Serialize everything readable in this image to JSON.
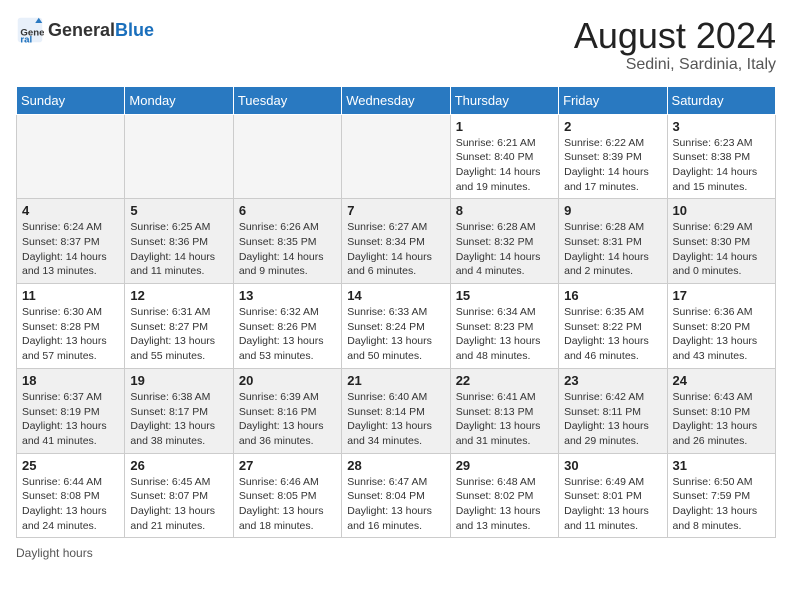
{
  "logo": {
    "text_general": "General",
    "text_blue": "Blue"
  },
  "header": {
    "title": "August 2024",
    "subtitle": "Sedini, Sardinia, Italy"
  },
  "weekdays": [
    "Sunday",
    "Monday",
    "Tuesday",
    "Wednesday",
    "Thursday",
    "Friday",
    "Saturday"
  ],
  "footer": {
    "note": "Daylight hours"
  },
  "weeks": [
    [
      {
        "day": "",
        "info": ""
      },
      {
        "day": "",
        "info": ""
      },
      {
        "day": "",
        "info": ""
      },
      {
        "day": "",
        "info": ""
      },
      {
        "day": "1",
        "info": "Sunrise: 6:21 AM\nSunset: 8:40 PM\nDaylight: 14 hours\nand 19 minutes."
      },
      {
        "day": "2",
        "info": "Sunrise: 6:22 AM\nSunset: 8:39 PM\nDaylight: 14 hours\nand 17 minutes."
      },
      {
        "day": "3",
        "info": "Sunrise: 6:23 AM\nSunset: 8:38 PM\nDaylight: 14 hours\nand 15 minutes."
      }
    ],
    [
      {
        "day": "4",
        "info": "Sunrise: 6:24 AM\nSunset: 8:37 PM\nDaylight: 14 hours\nand 13 minutes."
      },
      {
        "day": "5",
        "info": "Sunrise: 6:25 AM\nSunset: 8:36 PM\nDaylight: 14 hours\nand 11 minutes."
      },
      {
        "day": "6",
        "info": "Sunrise: 6:26 AM\nSunset: 8:35 PM\nDaylight: 14 hours\nand 9 minutes."
      },
      {
        "day": "7",
        "info": "Sunrise: 6:27 AM\nSunset: 8:34 PM\nDaylight: 14 hours\nand 6 minutes."
      },
      {
        "day": "8",
        "info": "Sunrise: 6:28 AM\nSunset: 8:32 PM\nDaylight: 14 hours\nand 4 minutes."
      },
      {
        "day": "9",
        "info": "Sunrise: 6:28 AM\nSunset: 8:31 PM\nDaylight: 14 hours\nand 2 minutes."
      },
      {
        "day": "10",
        "info": "Sunrise: 6:29 AM\nSunset: 8:30 PM\nDaylight: 14 hours\nand 0 minutes."
      }
    ],
    [
      {
        "day": "11",
        "info": "Sunrise: 6:30 AM\nSunset: 8:28 PM\nDaylight: 13 hours\nand 57 minutes."
      },
      {
        "day": "12",
        "info": "Sunrise: 6:31 AM\nSunset: 8:27 PM\nDaylight: 13 hours\nand 55 minutes."
      },
      {
        "day": "13",
        "info": "Sunrise: 6:32 AM\nSunset: 8:26 PM\nDaylight: 13 hours\nand 53 minutes."
      },
      {
        "day": "14",
        "info": "Sunrise: 6:33 AM\nSunset: 8:24 PM\nDaylight: 13 hours\nand 50 minutes."
      },
      {
        "day": "15",
        "info": "Sunrise: 6:34 AM\nSunset: 8:23 PM\nDaylight: 13 hours\nand 48 minutes."
      },
      {
        "day": "16",
        "info": "Sunrise: 6:35 AM\nSunset: 8:22 PM\nDaylight: 13 hours\nand 46 minutes."
      },
      {
        "day": "17",
        "info": "Sunrise: 6:36 AM\nSunset: 8:20 PM\nDaylight: 13 hours\nand 43 minutes."
      }
    ],
    [
      {
        "day": "18",
        "info": "Sunrise: 6:37 AM\nSunset: 8:19 PM\nDaylight: 13 hours\nand 41 minutes."
      },
      {
        "day": "19",
        "info": "Sunrise: 6:38 AM\nSunset: 8:17 PM\nDaylight: 13 hours\nand 38 minutes."
      },
      {
        "day": "20",
        "info": "Sunrise: 6:39 AM\nSunset: 8:16 PM\nDaylight: 13 hours\nand 36 minutes."
      },
      {
        "day": "21",
        "info": "Sunrise: 6:40 AM\nSunset: 8:14 PM\nDaylight: 13 hours\nand 34 minutes."
      },
      {
        "day": "22",
        "info": "Sunrise: 6:41 AM\nSunset: 8:13 PM\nDaylight: 13 hours\nand 31 minutes."
      },
      {
        "day": "23",
        "info": "Sunrise: 6:42 AM\nSunset: 8:11 PM\nDaylight: 13 hours\nand 29 minutes."
      },
      {
        "day": "24",
        "info": "Sunrise: 6:43 AM\nSunset: 8:10 PM\nDaylight: 13 hours\nand 26 minutes."
      }
    ],
    [
      {
        "day": "25",
        "info": "Sunrise: 6:44 AM\nSunset: 8:08 PM\nDaylight: 13 hours\nand 24 minutes."
      },
      {
        "day": "26",
        "info": "Sunrise: 6:45 AM\nSunset: 8:07 PM\nDaylight: 13 hours\nand 21 minutes."
      },
      {
        "day": "27",
        "info": "Sunrise: 6:46 AM\nSunset: 8:05 PM\nDaylight: 13 hours\nand 18 minutes."
      },
      {
        "day": "28",
        "info": "Sunrise: 6:47 AM\nSunset: 8:04 PM\nDaylight: 13 hours\nand 16 minutes."
      },
      {
        "day": "29",
        "info": "Sunrise: 6:48 AM\nSunset: 8:02 PM\nDaylight: 13 hours\nand 13 minutes."
      },
      {
        "day": "30",
        "info": "Sunrise: 6:49 AM\nSunset: 8:01 PM\nDaylight: 13 hours\nand 11 minutes."
      },
      {
        "day": "31",
        "info": "Sunrise: 6:50 AM\nSunset: 7:59 PM\nDaylight: 13 hours\nand 8 minutes."
      }
    ]
  ]
}
